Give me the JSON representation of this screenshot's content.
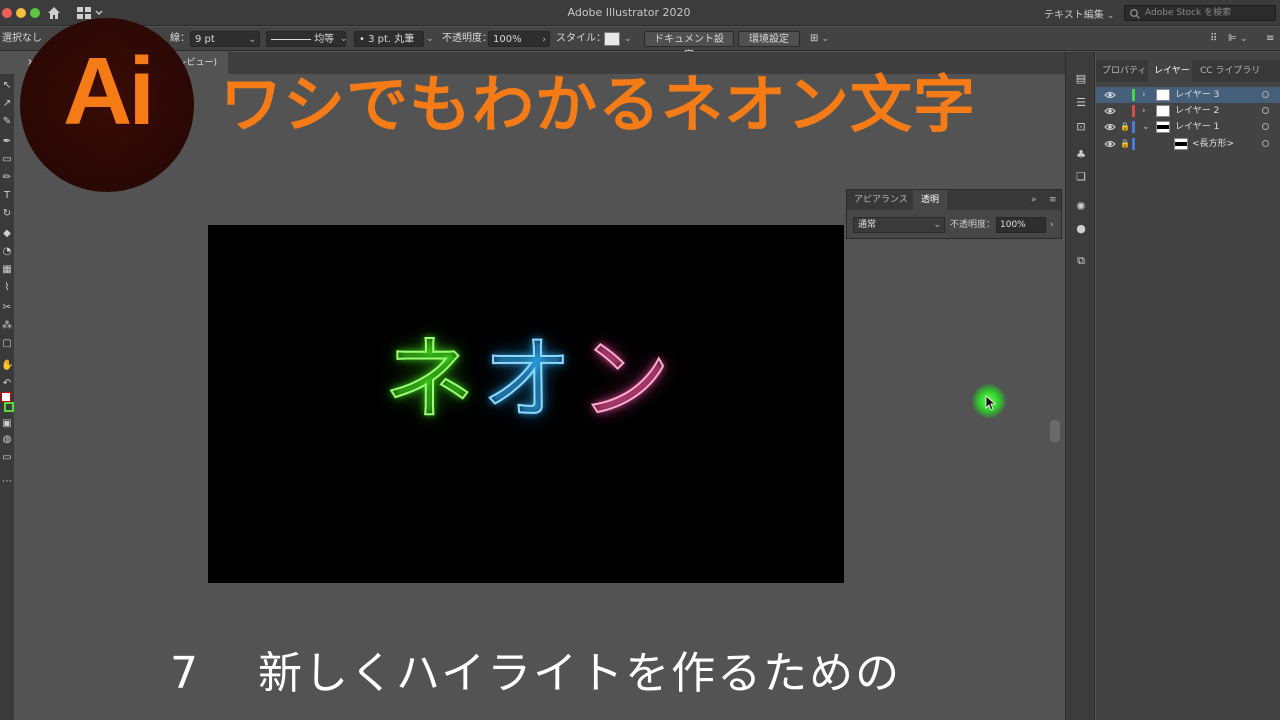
{
  "titlebar": {
    "title": "Adobe Illustrator 2020",
    "workspace": "テキスト編集",
    "search_placeholder": "Adobe Stock を検索"
  },
  "controlbar": {
    "selection": "選択なし",
    "stroke_label": "線：",
    "stroke_value": "9 pt",
    "profile_label": "均等",
    "brush_label": "3 pt. 丸筆",
    "opacity_label": "不透明度：",
    "opacity_value": "100%",
    "style_label": "スタイル：",
    "document_settings": "ドキュメント設定",
    "preferences": "環境設定"
  },
  "document_tab": {
    "label": "(レビュー)"
  },
  "artboard": {
    "neon_chars": [
      "ネ",
      "オ",
      "ン"
    ],
    "colors": {
      "green": "#9aff73",
      "blue": "#8fd8ff",
      "pink": "#ffa9cf"
    }
  },
  "layers_panel": {
    "tabs": [
      "プロパティ",
      "レイヤー",
      "CC ライブラリ"
    ],
    "active_tab": "レイヤー",
    "rows": [
      {
        "name": "レイヤー 3",
        "selected": true,
        "color": "#4bd44b"
      },
      {
        "name": "レイヤー 2",
        "selected": false,
        "color": "#d94a4a"
      },
      {
        "name": "レイヤー 1",
        "selected": false,
        "color": "#4a7bd9"
      },
      {
        "name": "<長方形>",
        "selected": false,
        "color": "#4a7bd9"
      }
    ]
  },
  "transparency_panel": {
    "tabs": [
      "アピアランス",
      "透明"
    ],
    "blend_mode": "通常",
    "opacity_label": "不透明度：",
    "opacity_value": "100%"
  },
  "overlay": {
    "logo_text": "Ai",
    "title": "ワシでもわかるネオン文字",
    "subtitle_number": "7",
    "subtitle": "新しくハイライトを作るための"
  },
  "theme": {
    "accent": "#f47b16",
    "canvas": "#535353"
  }
}
